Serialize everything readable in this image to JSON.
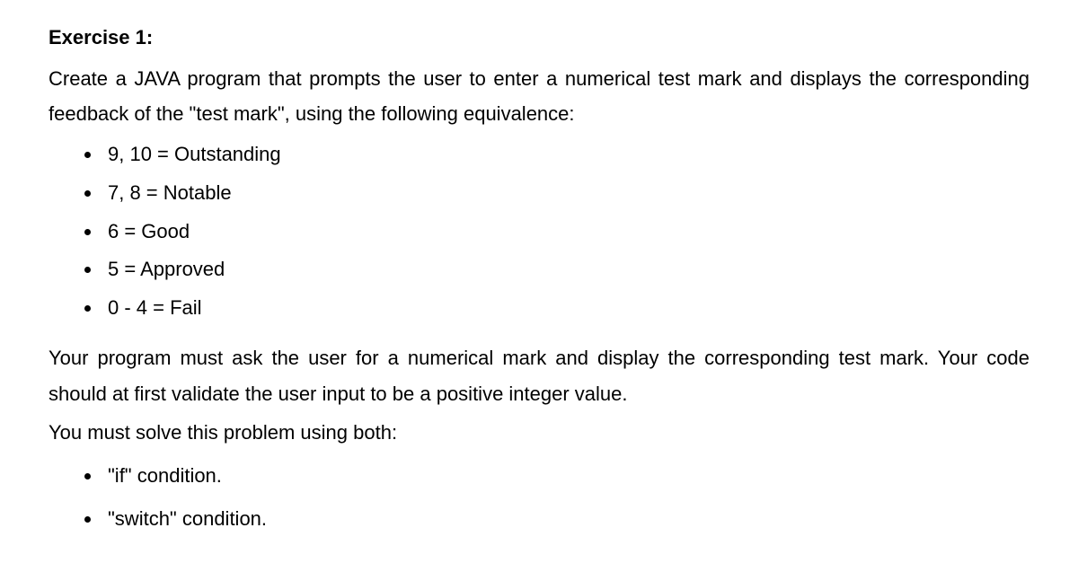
{
  "title": "Exercise 1:",
  "intro": "Create a JAVA program that prompts the user to enter a numerical test mark and displays the corresponding feedback of the \"test mark\", using the following equivalence:",
  "equivalences": [
    "9, 10 = Outstanding",
    "7, 8 = Notable",
    "6 = Good",
    "5 = Approved",
    "0 - 4 = Fail"
  ],
  "para2": "Your program must ask the user for a numerical mark and display the corresponding test mark. Your code should at first validate the user input to be a positive integer value.",
  "para3": "You must solve this problem using both:",
  "methods": [
    "\"if\" condition.",
    "\"switch\" condition."
  ]
}
